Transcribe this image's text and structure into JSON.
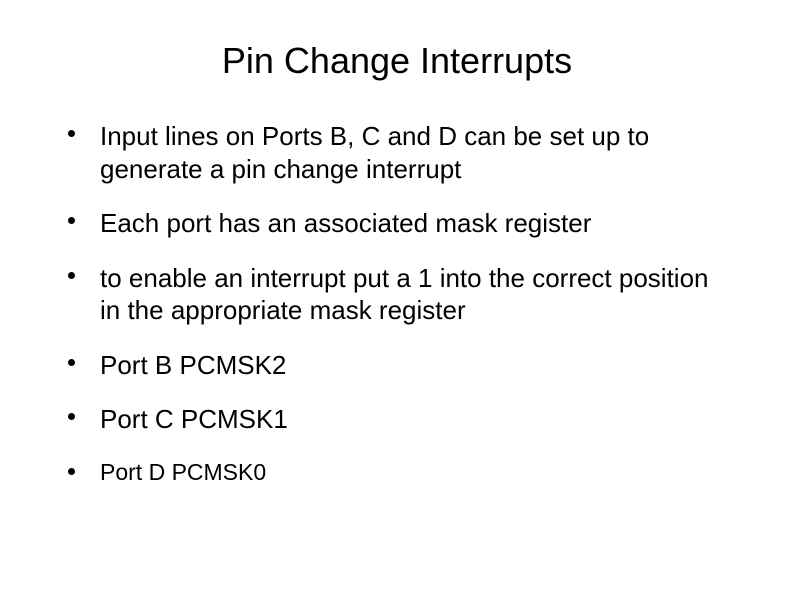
{
  "title": "Pin Change Interrupts",
  "bullets": [
    {
      "text": "Input lines on Ports B, C and D can be set up to generate a pin change interrupt",
      "size": "normal"
    },
    {
      "text": "Each port has an associated mask register",
      "size": "normal"
    },
    {
      "text": "to enable an interrupt put a 1 into the correct position in the appropriate mask register",
      "size": "normal"
    },
    {
      "text": "Port B PCMSK2",
      "size": "normal"
    },
    {
      "text": "Port C PCMSK1",
      "size": "normal"
    },
    {
      "text": "Port D PCMSK0",
      "size": "smaller"
    }
  ]
}
